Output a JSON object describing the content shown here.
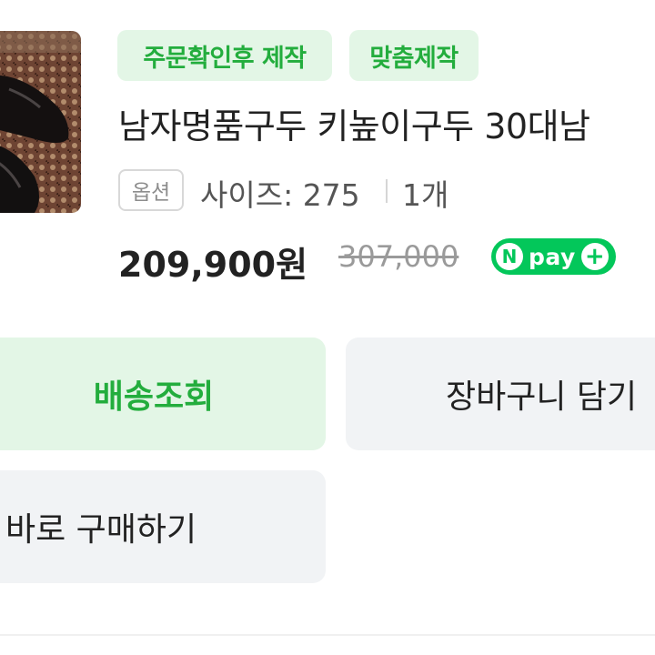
{
  "product": {
    "image_icon": "dress-shoes-photo",
    "tags": [
      "주문확인후 제작",
      "맞춤제작"
    ],
    "title": "남자명품구두 키높이구두 30대남",
    "option_badge": "옵션",
    "option_size": "사이즈: 275",
    "option_qty": "1개",
    "price": "209,900원",
    "original_price": "307,000",
    "npay": {
      "n": "N",
      "label": "pay",
      "plus": "+"
    }
  },
  "actions": {
    "delivery_label": "배송조회",
    "cart_label": "장바구니 담기",
    "buy_label": "바로 구매하기"
  },
  "colors": {
    "accent_green": "#23ad3d",
    "tag_background": "#e3f6e6",
    "npay_green": "#03c75a",
    "button_gray": "#f1f3f5"
  }
}
